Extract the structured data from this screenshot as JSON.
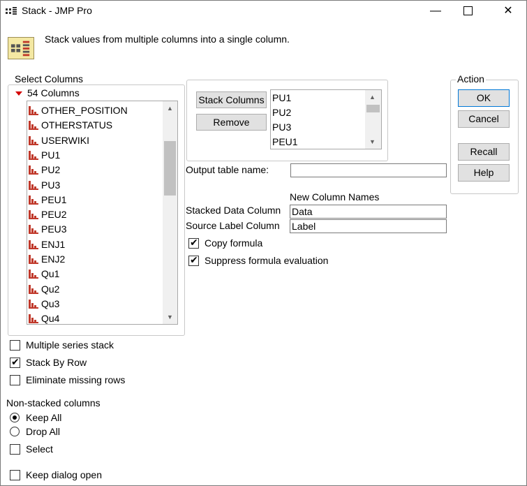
{
  "window": {
    "title": "Stack - JMP Pro",
    "minimize_icon": "minimize-icon",
    "maximize_icon": "maximize-icon",
    "close_icon": "close-icon"
  },
  "header": {
    "description": "Stack values from multiple columns into a single column."
  },
  "select_columns": {
    "group_label": "Select Columns",
    "count_label": "54 Columns",
    "items": [
      "OTHER_POSITION",
      "OTHERSTATUS",
      "USERWIKI",
      "PU1",
      "PU2",
      "PU3",
      "PEU1",
      "PEU2",
      "PEU3",
      "ENJ1",
      "ENJ2",
      "Qu1",
      "Qu2",
      "Qu3",
      "Qu4"
    ]
  },
  "stack": {
    "stack_button": "Stack Columns",
    "remove_button": "Remove",
    "items": [
      "PU1",
      "PU2",
      "PU3",
      "PEU1"
    ]
  },
  "output": {
    "table_name_label": "Output table name:",
    "table_name_value": ""
  },
  "new_names": {
    "header": "New Column Names",
    "stacked_label": "Stacked Data Column",
    "stacked_value": "Data",
    "source_label": "Source Label Column",
    "source_value": "Label"
  },
  "formula_options": {
    "copy_formula": "Copy formula",
    "suppress_eval": "Suppress formula evaluation"
  },
  "action": {
    "group_label": "Action",
    "ok": "OK",
    "cancel": "Cancel",
    "recall": "Recall",
    "help": "Help"
  },
  "options": {
    "multiple_series": "Multiple series stack",
    "stack_by_row": "Stack By Row",
    "eliminate_missing": "Eliminate missing rows"
  },
  "non_stacked": {
    "header": "Non-stacked columns",
    "keep_all": "Keep All",
    "drop_all": "Drop All",
    "select": "Select"
  },
  "footer": {
    "keep_open": "Keep dialog open"
  },
  "state": {
    "copy_formula": true,
    "suppress_eval": true,
    "multiple_series": false,
    "stack_by_row": true,
    "eliminate_missing": false,
    "non_stacked_choice": "Keep All",
    "select": false,
    "keep_open": false
  },
  "colors": {
    "column_icon": "#c0392b",
    "focus_border": "#0078d7"
  }
}
